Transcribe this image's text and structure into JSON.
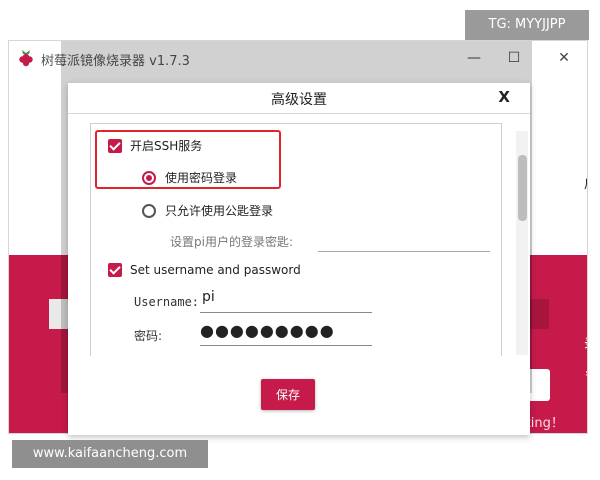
{
  "app": {
    "title": "树莓派镜像烧录器 v1.7.3"
  },
  "window_controls": {
    "minimize": "—",
    "maximize": "☐",
    "close": "✕"
  },
  "background_glyphs": {
    "right_top": "启",
    "right_mid": "录",
    "right_low": "，"
  },
  "dialog": {
    "title": "高级设置",
    "close_label": "X",
    "ssh": {
      "checkbox_label": "开启SSH服务",
      "checked": true,
      "radio_password": "使用密码登录",
      "radio_pubkey": "只允许使用公匙登录",
      "selected": "password",
      "pubkey_field_label": "设置pi用户的登录密匙:"
    },
    "user": {
      "checkbox_label": "Set username and password",
      "checked": true,
      "username_label": "Username:",
      "username_value": "pi",
      "password_label": "密码:",
      "password_dots": "●●●●●●●●●"
    },
    "save_label": "保存"
  },
  "overlays": {
    "tg": "TG: MYYJJPP",
    "site": "www.kaifaancheng.com",
    "csdn": "CSDN @Haohao-fighting！"
  },
  "colors": {
    "accent": "#c51a4a",
    "highlight_box": "#e0242b"
  }
}
